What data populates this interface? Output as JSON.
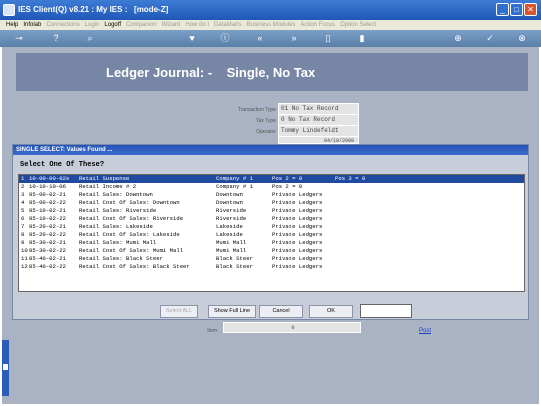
{
  "window": {
    "title": "IES Client(Q) v8.21 : My IES :   [mode-Z]",
    "buttons": [
      "_",
      "□",
      "✕"
    ]
  },
  "menu": {
    "items": [
      {
        "label": "Help",
        "dim": false
      },
      {
        "label": "Infolab",
        "dim": false
      },
      {
        "label": "Connections",
        "dim": true
      },
      {
        "label": "Login",
        "dim": true
      },
      {
        "label": "Logoff",
        "dim": false
      },
      {
        "label": "Companion",
        "dim": true
      },
      {
        "label": "Wizard",
        "dim": true
      },
      {
        "label": "How do I",
        "dim": true
      },
      {
        "label": "DataMarts",
        "dim": true
      },
      {
        "label": "Business Modules",
        "dim": true
      },
      {
        "label": "Action Focus",
        "dim": true
      },
      {
        "label": "Option Select",
        "dim": true
      }
    ]
  },
  "toolbar": {
    "icons": [
      "key-icon",
      "help-icon",
      "search-icon",
      "heart-icon",
      "info-icon",
      "rewind-icon",
      "forward-icon",
      "clipboard-icon",
      "panel-icon",
      "add-icon",
      "check-icon",
      "close-icon"
    ]
  },
  "header": {
    "title": "Ledger Journal: -    Single, No Tax"
  },
  "fields": {
    "transaction_type_label": "Transaction Type",
    "transaction_type": "01 No Tax Record",
    "tax_type_label": "Tax Type",
    "tax_type": "0 No Tax Record",
    "operator_label": "Operator",
    "operator": "Tommy Lindefeldt",
    "date": "04/10/2009"
  },
  "dialog": {
    "title": "SINGLE SELECT: Values Found ...",
    "prompt": "Select One Of These?",
    "rows": [
      {
        "n": "1",
        "code": "10-00-00-02s",
        "name": "Retail Suspense",
        "company": "Company # 1",
        "type": "Pos 2 = 0",
        "extra": "Pos 3 = 0",
        "selected": true
      },
      {
        "n": "2",
        "code": "10-10-10-06",
        "name": "Retail Income # 2",
        "company": "Company # 1",
        "type": "Pos 2 = 0",
        "extra": "",
        "selected": false
      },
      {
        "n": "3",
        "code": "85-00-02-21",
        "name": "Retail Sales: Downtown",
        "company": "Downtown",
        "type": "Private Ledgers",
        "extra": "",
        "selected": false
      },
      {
        "n": "4",
        "code": "85-00-02-22",
        "name": "Retail Cost Of Sales: Downtown",
        "company": "Downtown",
        "type": "Private Ledgers",
        "extra": "",
        "selected": false
      },
      {
        "n": "5",
        "code": "85-10-02-21",
        "name": "Retail Sales: Riverside",
        "company": "Riverside",
        "type": "Private Ledgers",
        "extra": "",
        "selected": false
      },
      {
        "n": "6",
        "code": "85-10-02-22",
        "name": "Retail Cost Of Sales: Riverside",
        "company": "Riverside",
        "type": "Private Ledgers",
        "extra": "",
        "selected": false
      },
      {
        "n": "7",
        "code": "85-20-02-21",
        "name": "Retail Sales: Lakeside",
        "company": "Lakeside",
        "type": "Private Ledgers",
        "extra": "",
        "selected": false
      },
      {
        "n": "8",
        "code": "85-20-02-22",
        "name": "Retail Cost Of Sales: Lakeside",
        "company": "Lakeside",
        "type": "Private Ledgers",
        "extra": "",
        "selected": false
      },
      {
        "n": "9",
        "code": "85-30-02-21",
        "name": "Retail Sales: Mumi Mall",
        "company": "Mumi Mall",
        "type": "Private Ledgers",
        "extra": "",
        "selected": false
      },
      {
        "n": "10",
        "code": "85-30-02-22",
        "name": "Retail Cost Of Sales: Mumi Mall",
        "company": "Mumi Mall",
        "type": "Private Ledgers",
        "extra": "",
        "selected": false
      },
      {
        "n": "11",
        "code": "85-40-02-21",
        "name": "Retail Sales: Black Steer",
        "company": "Black Steer",
        "type": "Private Ledgers",
        "extra": "",
        "selected": false
      },
      {
        "n": "12",
        "code": "85-40-02-22",
        "name": "Retail Cost Of Sales: Black Steer",
        "company": "Black Steer",
        "type": "Private Ledgers",
        "extra": "",
        "selected": false
      }
    ],
    "buttons": {
      "select_all": "Select ALL",
      "show_full_line": "Show Full Line",
      "cancel": "Cancel",
      "ok": "OK"
    }
  },
  "footer": {
    "item_label": "Item",
    "item_value": "0",
    "post_link": "Post"
  },
  "colors": {
    "title_bar": "#1f57b8",
    "header_band": "#7886a6",
    "selection": "#1f4aa0"
  }
}
